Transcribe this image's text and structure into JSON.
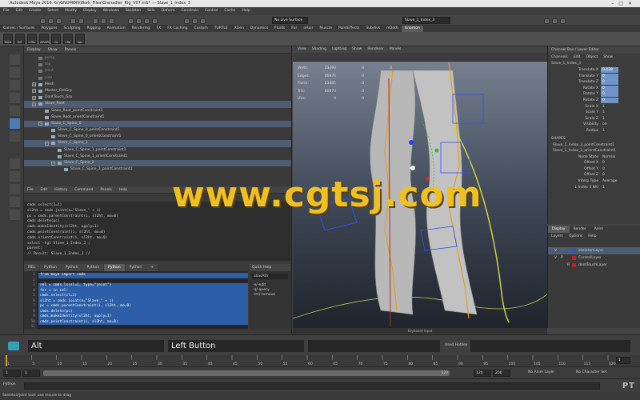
{
  "window": {
    "title": "Autodesk Maya 2016: G:\\GNOMON\\Work_Files\\Grenadier_Rig_V07.mb*   ---   Slave_1_Index_3",
    "controls": [
      "–",
      "□",
      "✕"
    ]
  },
  "menubar": [
    "File",
    "Edit",
    "Create",
    "Select",
    "Modify",
    "Display",
    "Windows",
    "Skeleton",
    "Skin",
    "Deform",
    "Constrain",
    "Control",
    "Cache",
    "Help"
  ],
  "status": {
    "mode": "Rigging",
    "live_surface": "No Live Surface",
    "selected_name": "Slave_1_Index_3"
  },
  "shelf": {
    "tabs": [
      "Curves / Surfaces",
      "Polygons",
      "Sculpting",
      "Rigging",
      "Animation",
      "Rendering",
      "FX",
      "FX Caching",
      "Custom",
      "TURTLE",
      "XGen",
      "Dynamics",
      "Fluids",
      "Fur",
      "nHair",
      "Muscle",
      "PaintEffects",
      "Subdivs",
      "nCloth",
      "Gnomon"
    ],
    "active_tab": "Gnomon",
    "buttons": [
      "SKIN",
      "BIT",
      "CTRL",
      "ZIPAPA",
      "GJ",
      "LRA",
      "SeL"
    ]
  },
  "outliner": {
    "menu": [
      "Display",
      "Show",
      "Panels"
    ],
    "rows": [
      {
        "label": "persp",
        "indent": 0,
        "dim": true
      },
      {
        "label": "top",
        "indent": 0,
        "dim": true
      },
      {
        "label": "front",
        "indent": 0,
        "dim": true
      },
      {
        "label": "side",
        "indent": 0,
        "dim": true
      },
      {
        "label": "Mesh",
        "indent": 0,
        "exp": "+"
      },
      {
        "label": "Master_CtrlGrp",
        "indent": 0,
        "exp": "+"
      },
      {
        "label": "DontTouch_Grp",
        "indent": 0,
        "exp": "+"
      },
      {
        "label": "Slave_Root",
        "indent": 0,
        "exp": "–",
        "sel": true
      },
      {
        "label": "Slave_Root_pointConstraint1",
        "indent": 1
      },
      {
        "label": "Slave_Root_orientConstraint1",
        "indent": 1
      },
      {
        "label": "Slave_C_Spine_0",
        "indent": 1,
        "exp": "–",
        "sel": true
      },
      {
        "label": "Slave_C_Spine_0_pointConstraint1",
        "indent": 2
      },
      {
        "label": "Slave_C_Spine_0_orientConstraint1",
        "indent": 2
      },
      {
        "label": "Slave_C_Spine_1",
        "indent": 2,
        "exp": "–",
        "sel": true
      },
      {
        "label": "Slave_C_Spine_1_pointConstraint1",
        "indent": 3
      },
      {
        "label": "Slave_C_Spine_1_orientConstraint1",
        "indent": 3
      },
      {
        "label": "Slave_C_Spine_2",
        "indent": 3,
        "exp": "–",
        "sel": true
      },
      {
        "label": "Slave_C_Spine_2_pointConstraint1",
        "indent": 4
      }
    ]
  },
  "script_editor": {
    "menu": [
      "File",
      "Edit",
      "History",
      "Command",
      "Panels",
      "Help"
    ],
    "history": [
      "cmds.select(1=1)",
      "sl2ht = cmds.joint(n=\"Slave_\" + i)",
      "pc = cmds.parentConstraint(i, sl2ht, mo=0)",
      "cmds.delete(pc)",
      "cmds.makeIdentity(sl2ht, apply=1)",
      "cmds.pointConstraint(i, sl2ht, mo=0)",
      "cmds.orientConstraint(i, sl2ht, mo=0)",
      "select -tgl Slave_1_Index_3 ;",
      "parent;",
      "// Result: Slave_1_Index_3 //"
    ],
    "tabs": [
      "MEL",
      "Python",
      "Python",
      "Python",
      "Python",
      "Python",
      "+"
    ],
    "active_tab_index": 4,
    "line_numbers": [
      "1",
      "2",
      "3",
      "4",
      "5",
      "6",
      "7",
      "8",
      "9",
      "10",
      "11"
    ],
    "code": [
      {
        "text": "from maya import cmds",
        "hl": true
      },
      {
        "text": "",
        "hl": false
      },
      {
        "text": "sel = cmds.ls(sl=1, type=\"joint\")",
        "hl": true
      },
      {
        "text": "for i in sel:",
        "hl": true
      },
      {
        "text": "    cmds.select(cl=1)",
        "hl": true
      },
      {
        "text": "    sl2ht = cmds.joint(n=\"Slave_\" + i)",
        "hl": true
      },
      {
        "text": "    pc = cmds.parentConstraint(i, sl2ht, mo=0)",
        "hl": true
      },
      {
        "text": "    cmds.delete(pc)",
        "hl": true
      },
      {
        "text": "    cmds.makeIdentity(sl2ht, apply=1)",
        "hl": true
      },
      {
        "text": "    cmds.pointConstraint(i, sl2ht, mo=0)",
        "hl": true
      },
      {
        "text": "",
        "hl": false
      }
    ],
    "quick_help": {
      "title": "Quick Help",
      "field": "aliasAttr",
      "items": [
        "-e/-edit",
        "-q/-query",
        "-rm/-remove"
      ]
    }
  },
  "viewport": {
    "menu": [
      "View",
      "Shading",
      "Lighting",
      "Show",
      "Renderer",
      "Panels"
    ],
    "hud": [
      {
        "label": "Verts:",
        "value": "23490",
        "c2": "0",
        "c3": "0"
      },
      {
        "label": "Edges:",
        "value": "46976",
        "c2": "0",
        "c3": "0"
      },
      {
        "label": "Faces:",
        "value": "23485",
        "c2": "0",
        "c3": "0"
      },
      {
        "label": "Tris:",
        "value": "46970",
        "c2": "0",
        "c3": "0"
      },
      {
        "label": "UVs:",
        "value": "0",
        "c2": "0",
        "c3": "0"
      }
    ]
  },
  "watermark": "www.cgtsj.com",
  "channel_box": {
    "title": "Channel Box / Layer Editor",
    "menu": [
      "Channels",
      "Edit",
      "Object",
      "Show"
    ],
    "object": "Slave_1_Index_3",
    "attributes": [
      {
        "name": "Translate X",
        "value": "0.438",
        "blue": true
      },
      {
        "name": "Translate Y",
        "value": "0",
        "blue": true
      },
      {
        "name": "Translate Z",
        "value": "0",
        "blue": true
      },
      {
        "name": "Rotate X",
        "value": "0",
        "blue": true
      },
      {
        "name": "Rotate Y",
        "value": "0",
        "blue": true
      },
      {
        "name": "Rotate Z",
        "value": "0",
        "blue": true
      },
      {
        "name": "Scale X",
        "value": "1",
        "blue": false
      },
      {
        "name": "Scale Y",
        "value": "1",
        "blue": false
      },
      {
        "name": "Scale Z",
        "value": "1",
        "blue": false
      },
      {
        "name": "Visibility",
        "value": "on",
        "blue": false
      },
      {
        "name": "Radius",
        "value": "1",
        "blue": false
      }
    ],
    "shapes_header": "SHAPES",
    "shapes": [
      "Slave_1_Index_3_pointConstraint1",
      "Slave_1_Index_3_orientConstraint1"
    ],
    "inputs": [
      {
        "name": "Node State",
        "value": "Normal"
      },
      {
        "name": "Offset X",
        "value": "0"
      },
      {
        "name": "Offset Y",
        "value": "0"
      },
      {
        "name": "Offset Z",
        "value": "0"
      },
      {
        "name": "Interp Type",
        "value": "Average"
      },
      {
        "name": "L Index 3 W0",
        "value": "1"
      }
    ]
  },
  "layer_editor": {
    "tabs": [
      "Display",
      "Render",
      "Anim"
    ],
    "menu": [
      "Layers",
      "Options",
      "Help"
    ],
    "layers": [
      {
        "v": "V",
        "p": "",
        "r": "",
        "name": "skeletonLayer",
        "color": "#2e54c9",
        "sel": true
      },
      {
        "v": "V",
        "p": "P",
        "r": "",
        "name": "ControlLayer",
        "color": "#c02020",
        "sel": false
      },
      {
        "v": "",
        "p": "",
        "r": "R",
        "name": "dontTouchLayer",
        "color": "#c02020",
        "sel": false
      }
    ]
  },
  "keyboard_bar": "Keyboard Input",
  "big_status": {
    "key": "Alt",
    "mouse": "Left Button",
    "used_hotkey_label": "Used Hotkey"
  },
  "timeline": {
    "ticks": [
      "1",
      "5",
      "10",
      "15",
      "20",
      "25",
      "30",
      "35",
      "40",
      "45",
      "50",
      "55",
      "60",
      "65",
      "70",
      "75",
      "80",
      "85",
      "90",
      "95",
      "100",
      "105",
      "110",
      "115",
      "120"
    ],
    "current_frame": "1"
  },
  "range": {
    "start": "1",
    "start_inner": "1",
    "slider_value": "120",
    "end_inner": "120",
    "end": "200",
    "anim_layer": "No Anim Layer",
    "char_set": "No Character Set"
  },
  "cmdline": {
    "lang": "Python"
  },
  "help_line": "Skeleton/joint tool: use mouse to drag"
}
